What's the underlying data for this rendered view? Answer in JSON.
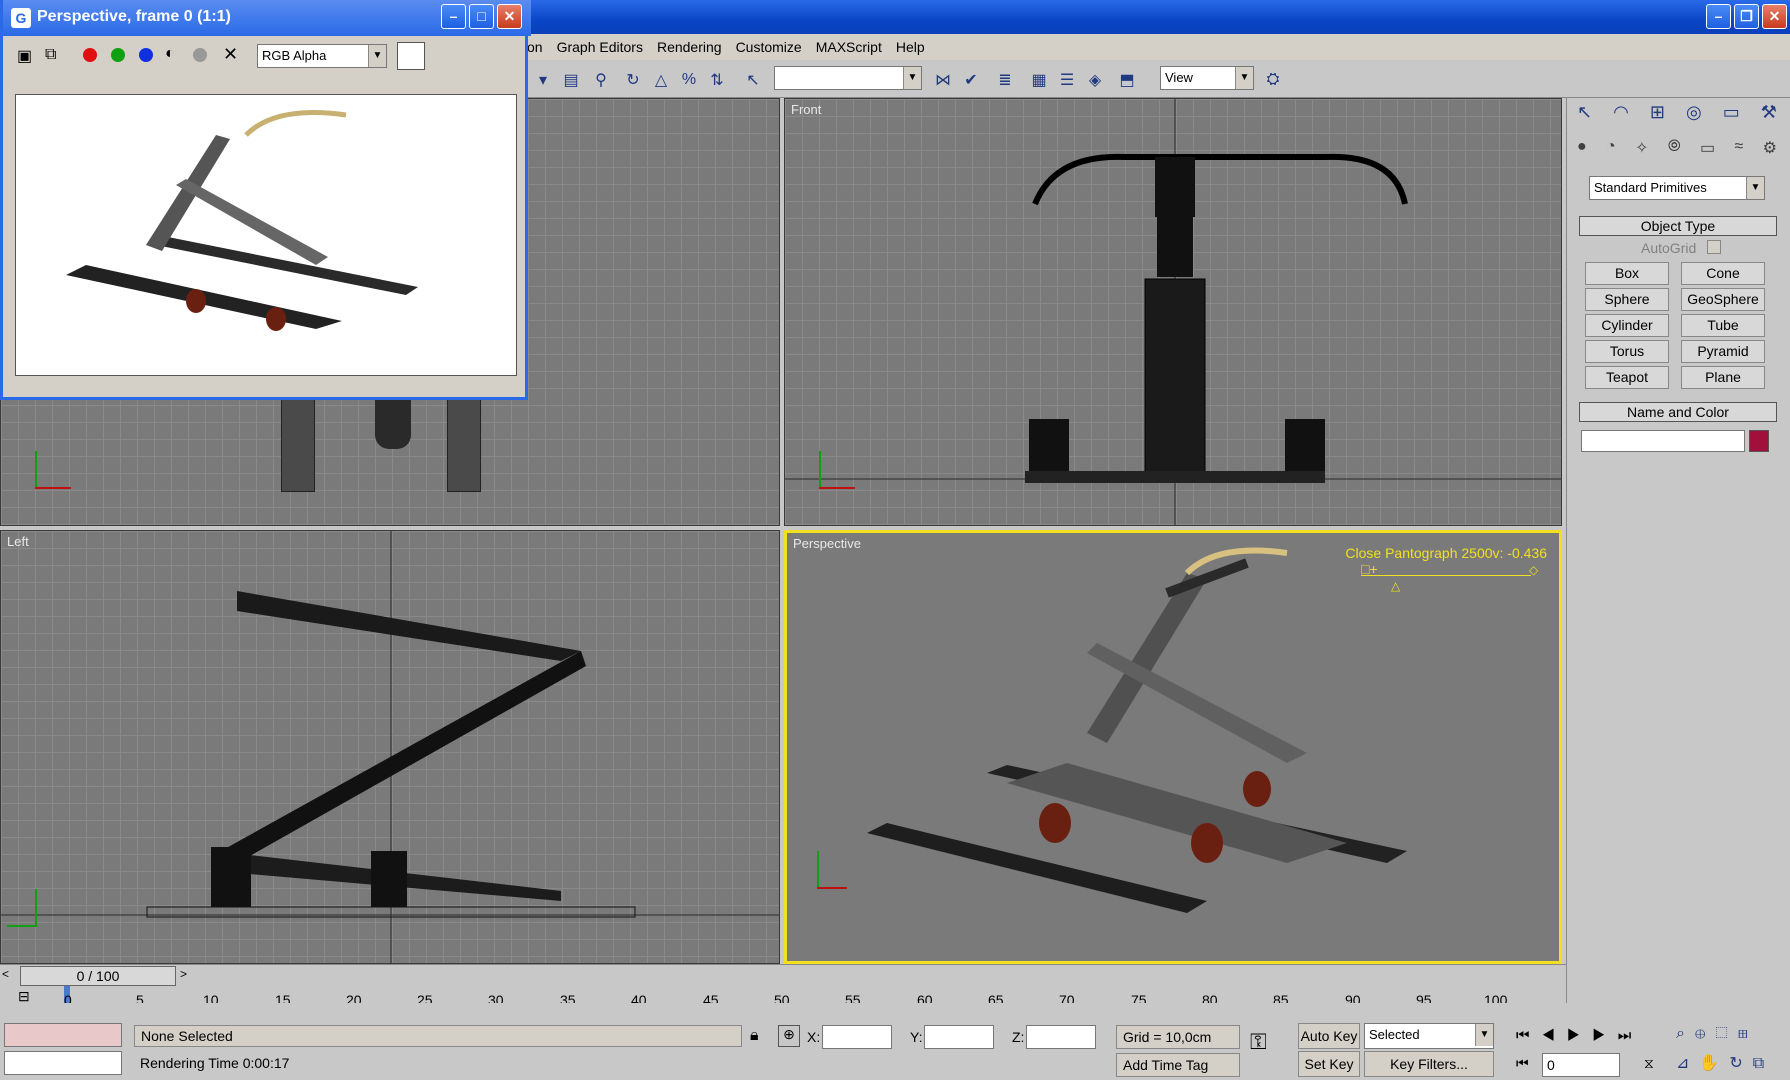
{
  "menu": [
    "on",
    "Graph Editors",
    "Rendering",
    "Customize",
    "MAXScript",
    "Help"
  ],
  "toolbar": {
    "view_combo": "View"
  },
  "render_window": {
    "title": "Perspective, frame 0 (1:1)",
    "channel": "RGB Alpha"
  },
  "viewports": {
    "front": "Front",
    "left": "Left",
    "perspective": "Perspective",
    "morph_label": "Close Pantograph 2500v: -0.436"
  },
  "command_panel": {
    "category": "Standard Primitives",
    "object_type": "Object Type",
    "autogrid": "AutoGrid",
    "buttons": [
      "Box",
      "Cone",
      "Sphere",
      "GeoSphere",
      "Cylinder",
      "Tube",
      "Torus",
      "Pyramid",
      "Teapot",
      "Plane"
    ],
    "name_color": "Name and Color",
    "swatch_color": "#a0103a"
  },
  "timeline": {
    "frame": "0 / 100",
    "ticks": [
      "0",
      "5",
      "10",
      "15",
      "20",
      "25",
      "30",
      "35",
      "40",
      "45",
      "50",
      "55",
      "60",
      "65",
      "70",
      "75",
      "80",
      "85",
      "90",
      "95",
      "100"
    ]
  },
  "status": {
    "selection": "None Selected",
    "rendering_time": "Rendering Time  0:00:17",
    "x": "X:",
    "y": "Y:",
    "z": "Z:",
    "grid": "Grid = 10,0cm",
    "add_time_tag": "Add Time Tag",
    "auto_key": "Auto Key",
    "set_key": "Set Key",
    "selected": "Selected",
    "key_filters": "Key Filters...",
    "frame_field": "0"
  }
}
